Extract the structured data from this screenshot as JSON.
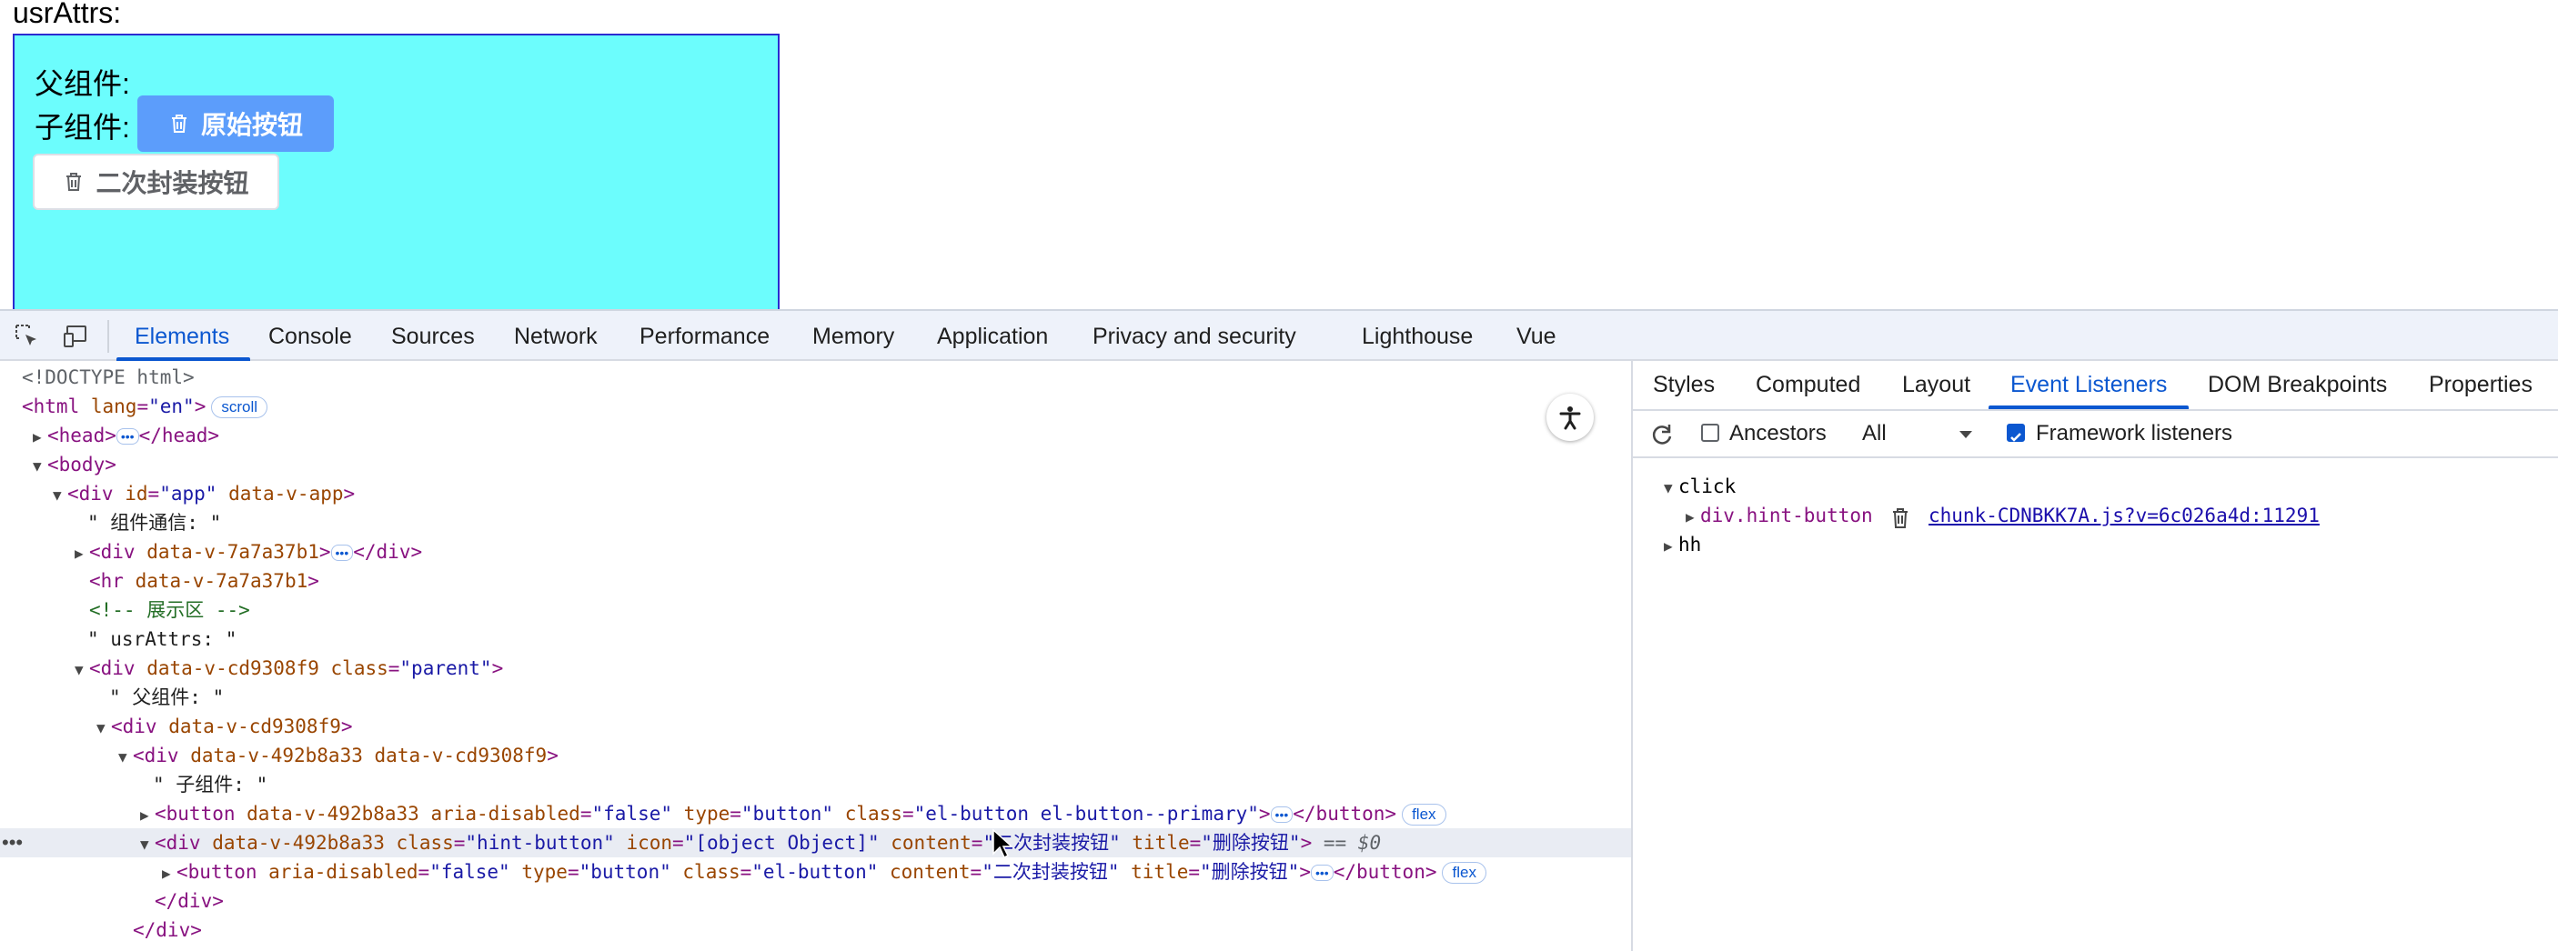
{
  "page": {
    "title": "usrAttrs:",
    "parent_label": "父组件:",
    "child_label": "子组件:",
    "primary_button": "原始按钮",
    "wrapped_button": "二次封装按钮"
  },
  "devtools": {
    "tabs": [
      "Elements",
      "Console",
      "Sources",
      "Network",
      "Performance",
      "Memory",
      "Application",
      "Privacy and security",
      "Lighthouse",
      "Vue"
    ],
    "active_tab": "Elements",
    "side_tabs": [
      "Styles",
      "Computed",
      "Layout",
      "Event Listeners",
      "DOM Breakpoints",
      "Properties"
    ],
    "active_side_tab": "Event Listeners",
    "listener_toolbar": {
      "ancestors_label": "Ancestors",
      "ancestors_checked": false,
      "filter_value": "All",
      "framework_label": "Framework listeners",
      "framework_checked": true
    },
    "listeners": {
      "event1": "click",
      "event1_node": "div.hint-button",
      "event1_source": "chunk-CDNBKK7A.js?v=6c026a4d:11291",
      "event2": "hh"
    },
    "dom": {
      "doctype": "<!DOCTYPE html>",
      "html_open": "<html",
      "html_attr": "lang",
      "html_val": "\"en\"",
      "scroll_badge": "scroll",
      "head": "<head>",
      "head_close": "</head>",
      "body": "<body>",
      "app_open": "<div",
      "app_id_attr": "id",
      "app_id_val": "\"app\"",
      "app_attr2": "data-v-app",
      "text1": "\" 组件通信: \"",
      "div_7a": "data-v-7a7a37b1",
      "div_close": "</div>",
      "hr": "<hr",
      "comment": "<!-- 展示区 -->",
      "text2": "\" usrAttrs: \"",
      "parent_attr": "data-v-cd9308f9",
      "class_attr": "class",
      "parent_class": "\"parent\"",
      "text3": "\" 父组件: \"",
      "child_attr": "data-v-492b8a33",
      "text4": "\" 子组件: \"",
      "btn_aria": "aria-disabled",
      "btn_aria_val": "\"false\"",
      "btn_type": "type",
      "btn_type_val": "\"button\"",
      "btn_class_val": "\"el-button el-button--primary\"",
      "btn_close": "</button>",
      "flex_badge": "flex",
      "hint_class_val": "\"hint-button\"",
      "icon_attr": "icon",
      "icon_val": "\"[object Object]\"",
      "content_attr": "content",
      "content_val": "\"二次封装按钮\"",
      "title_attr": "title",
      "title_val": "\"删除按钮\"",
      "selected_suffix": "== $0",
      "inner_btn_class_val": "\"el-button\""
    }
  },
  "colors": {
    "parent_bg": "#6cfdfd",
    "primary_btn": "#5c9dfb",
    "devtools_accent": "#0b57d0"
  }
}
